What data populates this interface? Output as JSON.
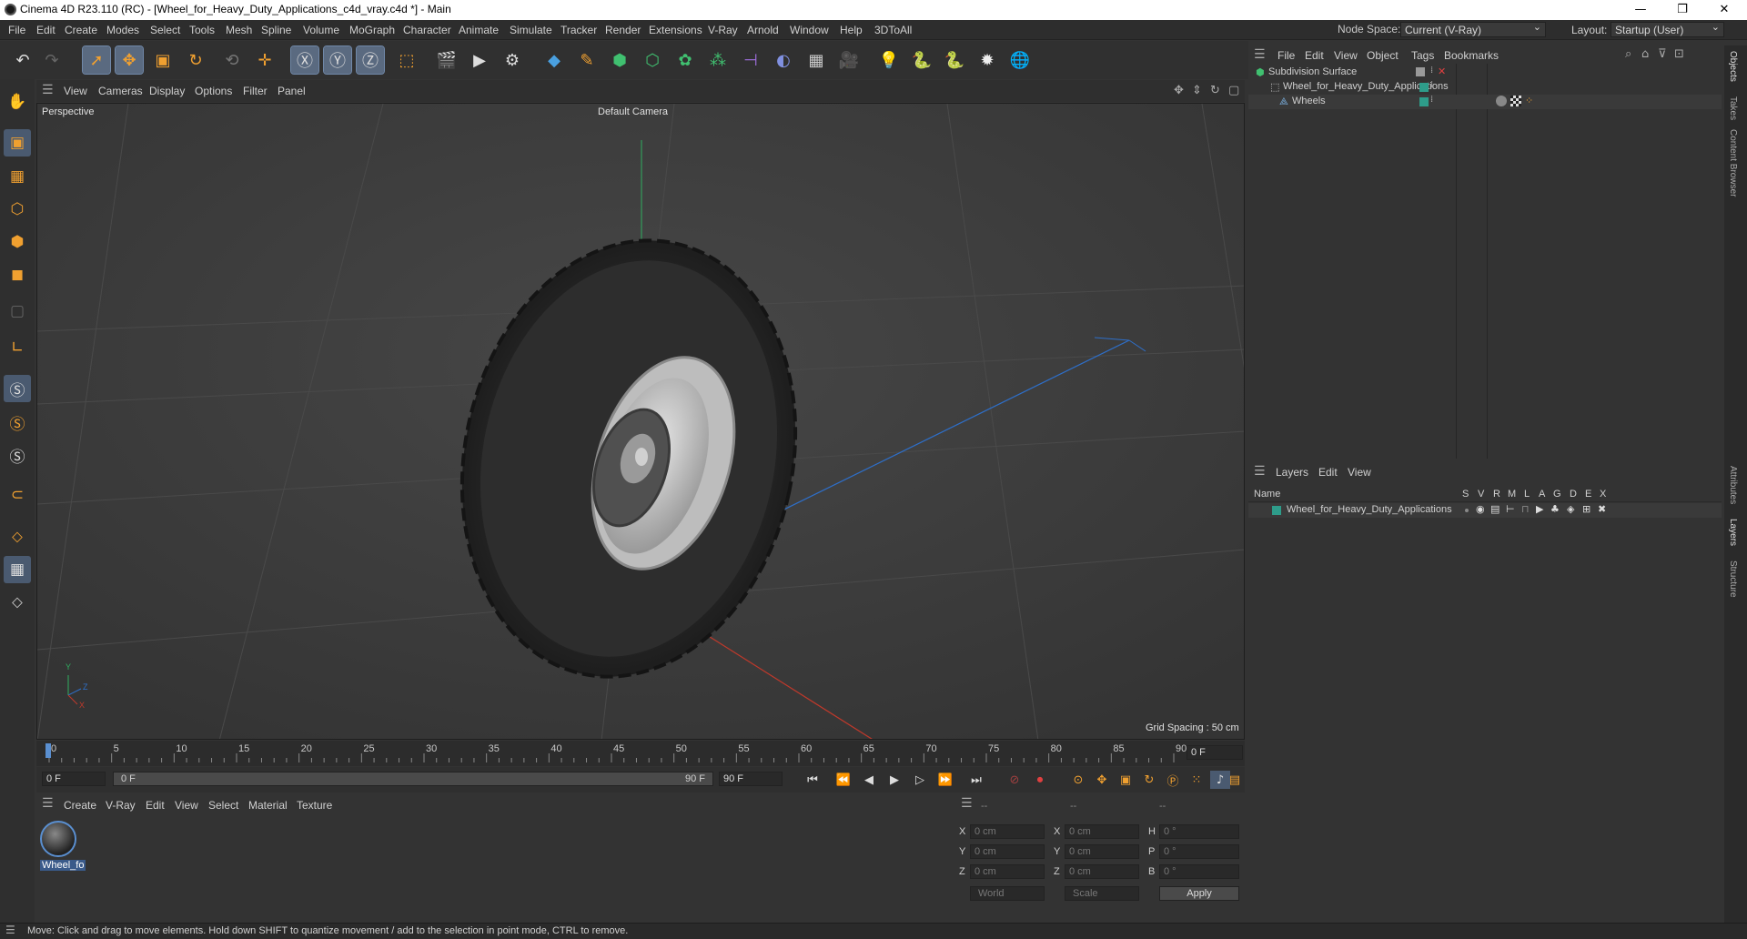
{
  "window": {
    "title": "Cinema 4D R23.110 (RC) - [Wheel_for_Heavy_Duty_Applications_c4d_vray.c4d *] - Main",
    "minimize": "—",
    "maximize": "❐",
    "close": "✕"
  },
  "menubar": {
    "items": [
      "File",
      "Edit",
      "Create",
      "Modes",
      "Select",
      "Tools",
      "Mesh",
      "Spline",
      "Volume",
      "MoGraph",
      "Character",
      "Animate",
      "Simulate",
      "Tracker",
      "Render",
      "Extensions",
      "V-Ray",
      "Arnold",
      "Window",
      "Help",
      "3DToAll"
    ],
    "node_space_label": "Node Space:",
    "node_space_value": "Current (V-Ray)",
    "layout_label": "Layout:",
    "layout_value": "Startup (User)"
  },
  "viewport": {
    "menu": [
      "View",
      "Cameras",
      "Display",
      "Options",
      "Filter",
      "Panel"
    ],
    "name": "Perspective",
    "camera": "Default Camera",
    "grid_spacing": "Grid Spacing : 50 cm",
    "axis_labels": {
      "y": "Y",
      "z": "Z",
      "x": "X"
    }
  },
  "timeline": {
    "ticks": [
      "0",
      "5",
      "10",
      "15",
      "20",
      "25",
      "30",
      "35",
      "40",
      "45",
      "50",
      "55",
      "60",
      "65",
      "70",
      "75",
      "80",
      "85",
      "90"
    ],
    "current_frame": "0 F"
  },
  "playbar": {
    "start": "0 F",
    "range_start": "0 F",
    "range_end": "90 F",
    "end": "90 F"
  },
  "material_panel": {
    "menu": [
      "Create",
      "V-Ray",
      "Edit",
      "View",
      "Select",
      "Material",
      "Texture"
    ],
    "material_name": "Wheel_fo"
  },
  "coord_panel": {
    "headers": [
      "--",
      "--",
      "--"
    ],
    "rows": [
      {
        "a": "X",
        "av": "0 cm",
        "b": "X",
        "bv": "0 cm",
        "c": "H",
        "cv": "0 °"
      },
      {
        "a": "Y",
        "av": "0 cm",
        "b": "Y",
        "bv": "0 cm",
        "c": "P",
        "cv": "0 °"
      },
      {
        "a": "Z",
        "av": "0 cm",
        "b": "Z",
        "bv": "0 cm",
        "c": "B",
        "cv": "0 °"
      }
    ],
    "world": "World",
    "scale": "Scale",
    "apply": "Apply"
  },
  "object_panel": {
    "menu": [
      "File",
      "Edit",
      "View",
      "Object",
      "Tags",
      "Bookmarks"
    ],
    "objects": [
      {
        "name": "Subdivision Surface",
        "indent": 0
      },
      {
        "name": "Wheel_for_Heavy_Duty_Applications",
        "indent": 1
      },
      {
        "name": "Wheels",
        "indent": 2
      }
    ]
  },
  "layer_panel": {
    "menu": [
      "Layers",
      "Edit",
      "View"
    ],
    "name_header": "Name",
    "col_headers": [
      "S",
      "V",
      "R",
      "M",
      "L",
      "A",
      "G",
      "D",
      "E",
      "X"
    ],
    "layer_name": "Wheel_for_Heavy_Duty_Applications"
  },
  "side_tabs": [
    "Objects",
    "Takes",
    "Content Browser",
    "Attributes",
    "Layers",
    "Structure"
  ],
  "status": "Move: Click and drag to move elements. Hold down SHIFT to quantize movement / add to the selection in point mode, CTRL to remove.",
  "colors": {
    "accent": "#5a6a80",
    "layer_color": "#2e9c8a",
    "axis_x": "#c0392b",
    "axis_y": "#27ae60",
    "axis_z": "#2e6fc9"
  }
}
